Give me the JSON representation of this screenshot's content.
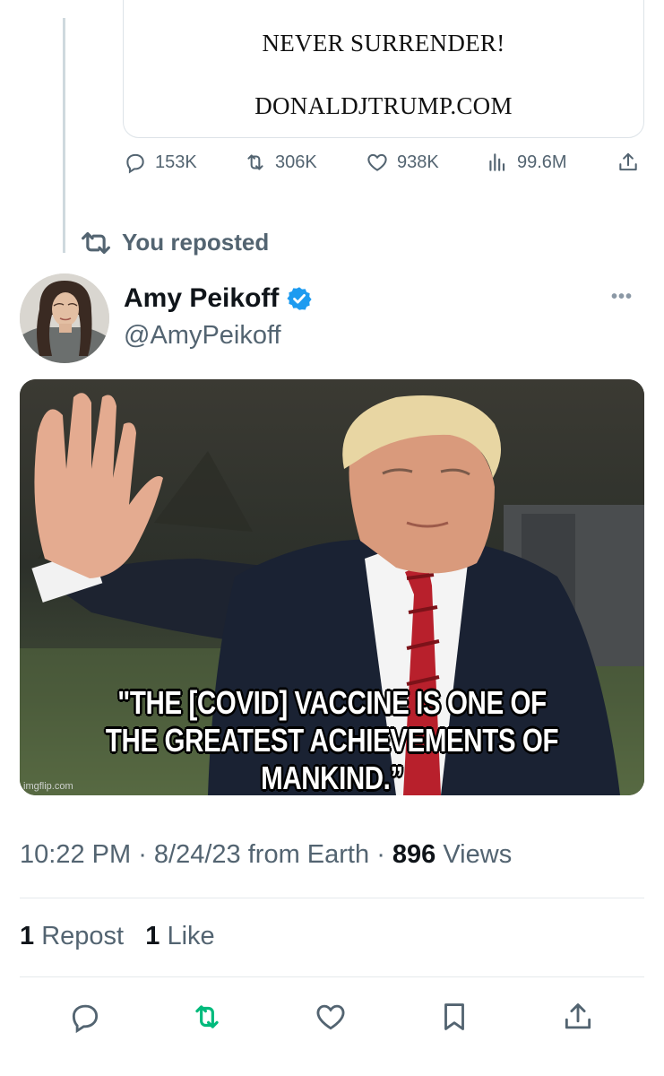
{
  "quoted_card": {
    "line1": "NEVER SURRENDER!",
    "line2": "DONALDJTRUMP.COM"
  },
  "quoted_stats": {
    "replies": "153K",
    "reposts": "306K",
    "likes": "938K",
    "views": "99.6M"
  },
  "repost_banner": "You reposted",
  "author": {
    "name": "Amy Peikoff",
    "handle": "@AmyPeikoff",
    "verified": true
  },
  "media": {
    "caption_line1": "\"THE [COVID] VACCINE IS ONE OF",
    "caption_line2": "THE GREATEST ACHIEVEMENTS OF MANKIND.”",
    "watermark": "imgflip.com"
  },
  "meta": {
    "time": "10:22 PM",
    "date": "8/24/23",
    "source": "from Earth",
    "views_count": "896",
    "views_label": "Views"
  },
  "engagement": {
    "repost_count": "1",
    "repost_label": "Repost",
    "like_count": "1",
    "like_label": "Like"
  },
  "colors": {
    "accent_blue": "#1d9bf0",
    "repost_green": "#00ba7c",
    "secondary_text": "#536471"
  },
  "icons": {
    "reply": "reply-icon",
    "repost": "repost-icon",
    "like": "heart-icon",
    "views": "analytics-icon",
    "share": "share-icon",
    "bookmark": "bookmark-icon",
    "more": "more-icon",
    "verified": "verified-badge-icon"
  }
}
